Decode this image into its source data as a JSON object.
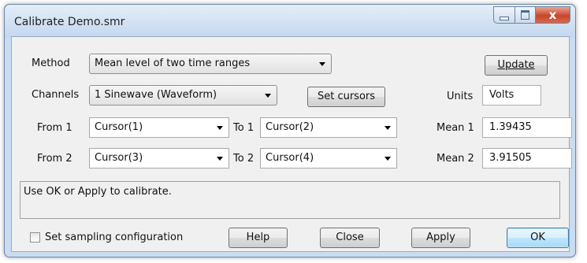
{
  "window": {
    "title": "Calibrate Demo.smr",
    "close_glyph": "x"
  },
  "method": {
    "label": "Method",
    "value": "Mean level of two time ranges"
  },
  "update_button": "Update",
  "channels": {
    "label": "Channels",
    "value": "1 Sinewave (Waveform)"
  },
  "set_cursors_button": "Set cursors",
  "units": {
    "label": "Units",
    "value": "Volts"
  },
  "range1": {
    "from_label": "From 1",
    "from_value": "Cursor(1)",
    "to_label": "To 1",
    "to_value": "Cursor(2)"
  },
  "range2": {
    "from_label": "From 2",
    "from_value": "Cursor(3)",
    "to_label": "To 2",
    "to_value": "Cursor(4)"
  },
  "mean1": {
    "label": "Mean 1",
    "value": "1.39435"
  },
  "mean2": {
    "label": "Mean 2",
    "value": "3.91505"
  },
  "status_text": "Use OK or Apply to calibrate.",
  "sampling_checkbox": {
    "label": "Set sampling configuration",
    "checked": false
  },
  "buttons": {
    "help": "Help",
    "close": "Close",
    "apply": "Apply",
    "ok": "OK"
  }
}
